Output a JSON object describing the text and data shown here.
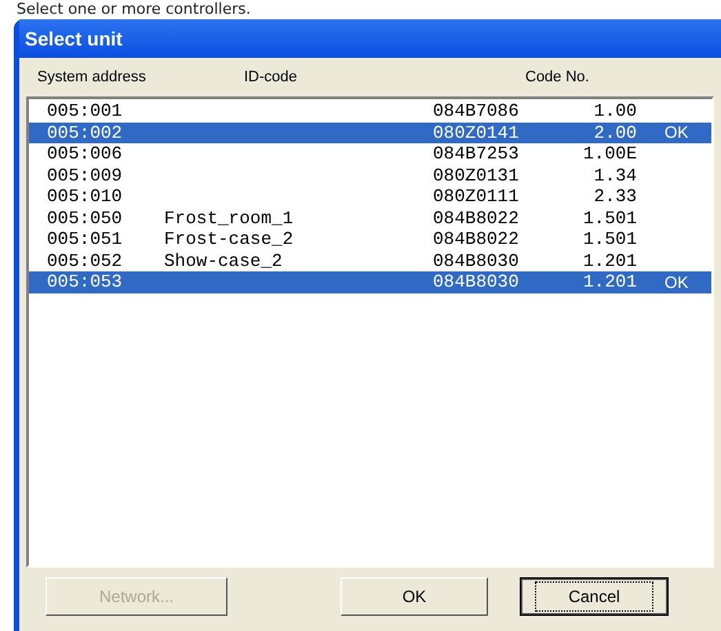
{
  "caption": "Select one or more controllers.",
  "window": {
    "title": "Select unit"
  },
  "columns": [
    "System address",
    "ID-code",
    "Code No."
  ],
  "rows": [
    {
      "address": "005:001",
      "id_code": "",
      "code_no": "084B7086",
      "version": "1.00",
      "status": "",
      "selected": false
    },
    {
      "address": "005:002",
      "id_code": "",
      "code_no": "080Z0141",
      "version": "2.00",
      "status": "OK",
      "selected": true
    },
    {
      "address": "005:006",
      "id_code": "",
      "code_no": "084B7253",
      "version": "1.00E",
      "status": "",
      "selected": false
    },
    {
      "address": "005:009",
      "id_code": "",
      "code_no": "080Z0131",
      "version": "1.34",
      "status": "",
      "selected": false
    },
    {
      "address": "005:010",
      "id_code": "",
      "code_no": "080Z0111",
      "version": "2.33",
      "status": "",
      "selected": false
    },
    {
      "address": "005:050",
      "id_code": "Frost_room_1",
      "code_no": "084B8022",
      "version": "1.501",
      "status": "",
      "selected": false
    },
    {
      "address": "005:051",
      "id_code": "Frost-case_2",
      "code_no": "084B8022",
      "version": "1.501",
      "status": "",
      "selected": false
    },
    {
      "address": "005:052",
      "id_code": "Show-case_2",
      "code_no": "084B8030",
      "version": "1.201",
      "status": "",
      "selected": false
    },
    {
      "address": "005:053",
      "id_code": "",
      "code_no": "084B8030",
      "version": "1.201",
      "status": "OK",
      "selected": true
    }
  ],
  "buttons": [
    {
      "label": "Network...",
      "disabled": true,
      "focused": false
    },
    {
      "label": "OK",
      "disabled": false,
      "focused": false
    },
    {
      "label": "Cancel",
      "disabled": false,
      "focused": true
    }
  ]
}
